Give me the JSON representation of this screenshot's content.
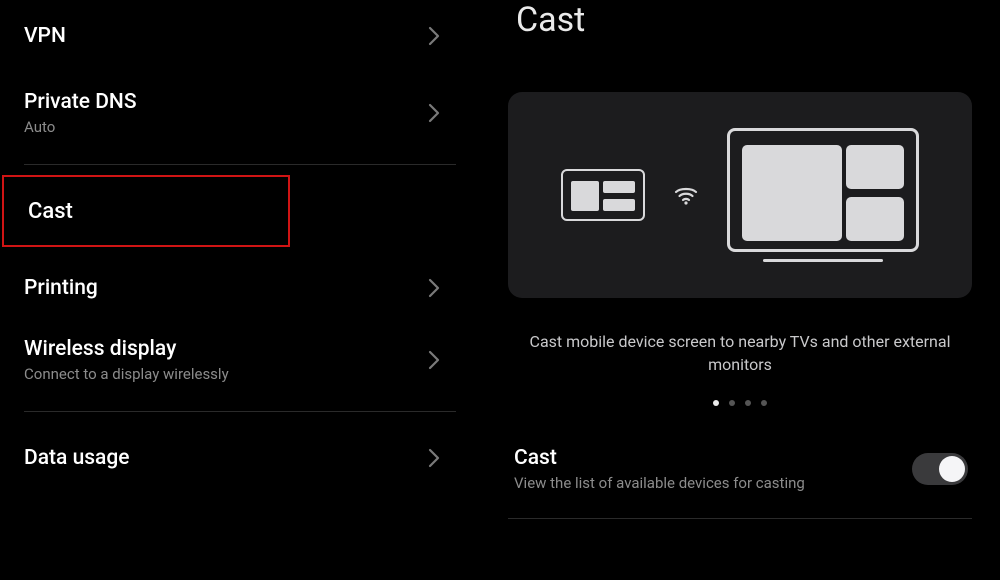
{
  "list": {
    "vpn": {
      "title": "VPN"
    },
    "private_dns": {
      "title": "Private DNS",
      "subtitle": "Auto"
    },
    "cast": {
      "title": "Cast"
    },
    "printing": {
      "title": "Printing"
    },
    "wireless_display": {
      "title": "Wireless display",
      "subtitle": "Connect to a display wirelessly"
    },
    "data_usage": {
      "title": "Data usage"
    }
  },
  "detail": {
    "page_title": "Cast",
    "caption": "Cast mobile device screen to nearby TVs and other external monitors",
    "page_indicator": {
      "count": 4,
      "active": 0
    },
    "toggle": {
      "title": "Cast",
      "subtitle": "View the list of available devices for casting",
      "on": false
    }
  },
  "colors": {
    "highlight": "#d01414",
    "divider": "#2a2a2a",
    "card_bg": "#1c1c1e"
  }
}
